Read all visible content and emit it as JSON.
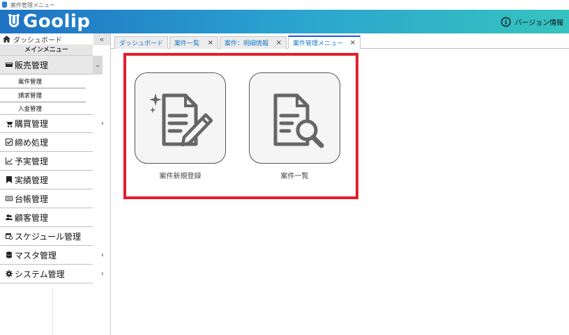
{
  "window": {
    "title": "案件管理メニュー"
  },
  "header": {
    "logo_text": "Goolip",
    "version_label": "バージョン情報"
  },
  "sidebar": {
    "home_label": "ダッシュボード",
    "collapse_label": "«",
    "menu_title": "メインメニュー",
    "items": [
      {
        "label": "販売管理",
        "icon": "register-icon",
        "expanded": true,
        "arrow": "⌄",
        "children": [
          {
            "label": "案件管理"
          },
          {
            "label": "請求管理"
          },
          {
            "label": "入金管理"
          }
        ]
      },
      {
        "label": "購買管理",
        "icon": "cart-icon",
        "arrow": "‹"
      },
      {
        "label": "締め処理",
        "icon": "checkbox-icon",
        "arrow": ""
      },
      {
        "label": "予実管理",
        "icon": "line-chart-icon",
        "arrow": ""
      },
      {
        "label": "実績管理",
        "icon": "bookmark-icon",
        "arrow": ""
      },
      {
        "label": "台帳管理",
        "icon": "keyboard-icon",
        "arrow": ""
      },
      {
        "label": "顧客管理",
        "icon": "users-icon",
        "arrow": ""
      },
      {
        "label": "スケジュール管理",
        "icon": "calendar-icon",
        "arrow": ""
      },
      {
        "label": "マスタ管理",
        "icon": "database-icon",
        "arrow": "‹"
      },
      {
        "label": "システム管理",
        "icon": "gear-icon",
        "arrow": "‹"
      }
    ]
  },
  "tabs": [
    {
      "label": "ダッシュボード",
      "closable": false,
      "active": false
    },
    {
      "label": "案件一覧",
      "closable": true,
      "active": false
    },
    {
      "label": "案件：明細情報",
      "closable": true,
      "active": false
    },
    {
      "label": "案件管理メニュー",
      "closable": true,
      "active": true
    }
  ],
  "tab_close_glyph": "×",
  "tiles": [
    {
      "label": "案件新規登録",
      "icon": "document-edit-icon"
    },
    {
      "label": "案件一覧",
      "icon": "document-search-icon"
    }
  ],
  "colors": {
    "header_start": "#1f72c4",
    "header_end": "#36c3c0",
    "highlight": "#e41e2b",
    "tab_text": "#1a7bc8"
  }
}
